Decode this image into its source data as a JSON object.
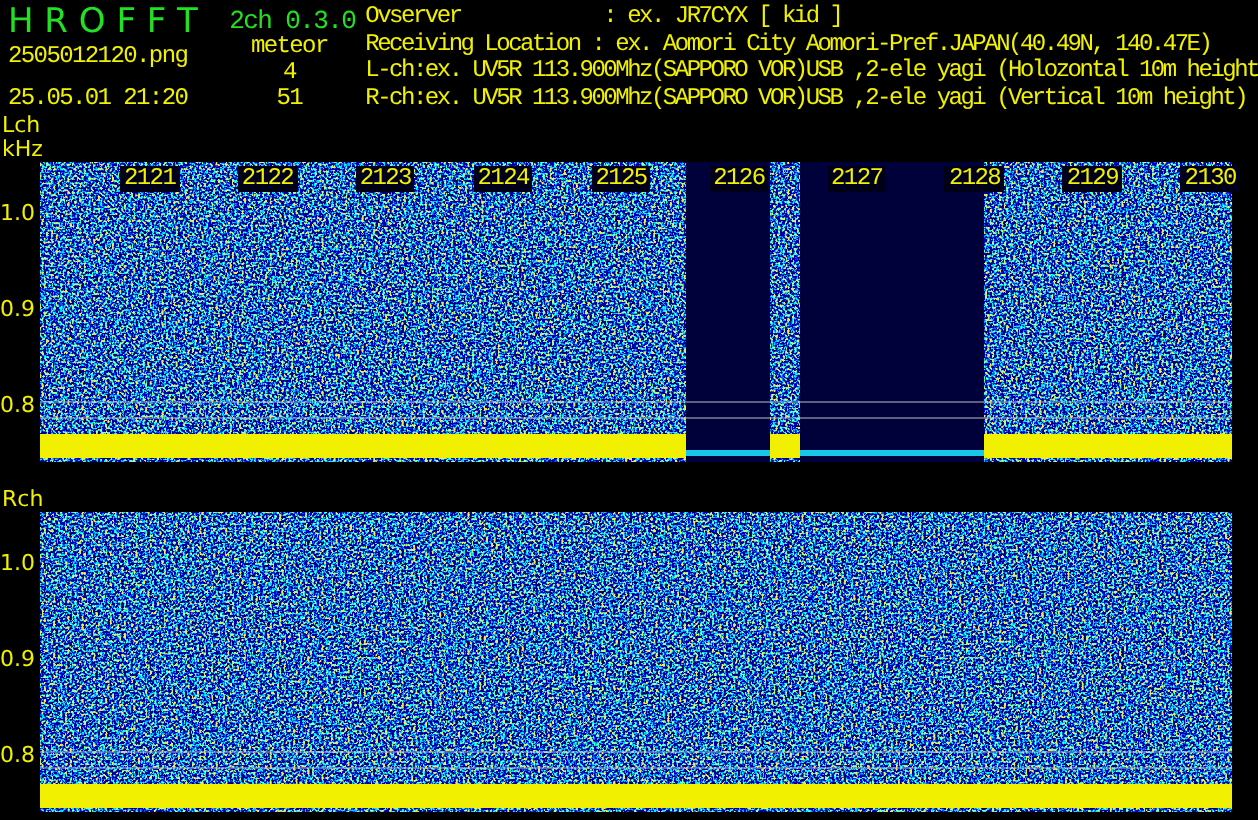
{
  "app": {
    "title": "H R O F F T",
    "version": "2ch 0.3.0",
    "file": "2505012120.png",
    "datetime": "25.05.01 21:20",
    "counter_label": "meteor",
    "counts": [
      "4",
      "51"
    ]
  },
  "info_lines": [
    "Ovserver            : ex. JR7CYX [ kid ]",
    "Receiving Location : ex. Aomori City Aomori-Pref.JAPAN(40.49N, 140.47E)",
    "L-ch:ex. UV5R 113.900Mhz(SAPPORO VOR)USB ,2-ele yagi (Holozontal 10m height",
    "R-ch:ex. UV5R 113.900Mhz(SAPPORO VOR)USB ,2-ele yagi (Vertical 10m height)"
  ],
  "panels": [
    {
      "label": "Lch",
      "unit": "kHz",
      "kind": "gaps",
      "time_labels": [
        "2121",
        "2122",
        "2123",
        "2124",
        "2125",
        "2126",
        "2127",
        "2128",
        "2129",
        "2130"
      ],
      "y_labels": [
        "1.0",
        "0.9",
        "0.8"
      ]
    },
    {
      "label": "Rch",
      "kind": "plain",
      "y_labels": [
        "1.0",
        "0.9",
        "0.8"
      ]
    }
  ]
}
